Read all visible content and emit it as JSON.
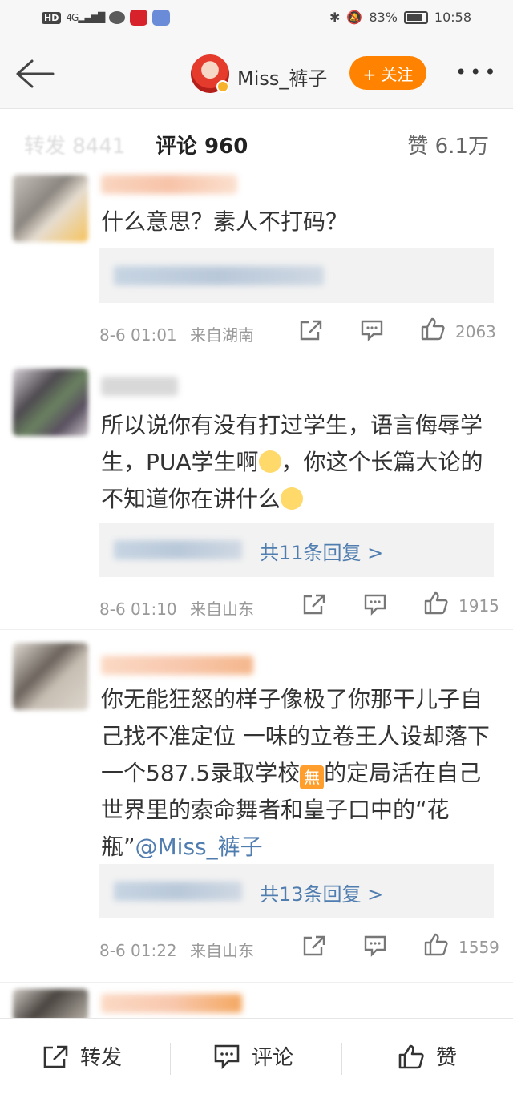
{
  "status_bar": {
    "network": "HD",
    "signal": "4G",
    "battery": "83%",
    "time": "10:58"
  },
  "nav": {
    "user_name": "Miss_裤子",
    "follow_label": "+ 关注",
    "more_label": "•••"
  },
  "tabs": {
    "repost_label": "转发 8441",
    "comment_label": "评论 960",
    "like_label": "赞 6.1万"
  },
  "comments": [
    {
      "text": "什么意思？素人不打码？",
      "time": "8-6 01:01",
      "location": "来自湖南",
      "likes": "2063",
      "reply_link": ""
    },
    {
      "text_a": "所以说你有没有打过学生，语言侮辱学生，PUA学生啊",
      "text_b": "，你这个长篇大论的不知道你在讲什么",
      "time": "8-6 01:10",
      "location": "来自山东",
      "likes": "1915",
      "reply_link": "共11条回复 >"
    },
    {
      "text_a": "你无能狂怒的样子像极了你那干儿子自己找不准定位 一味的立卷王人设却落下一个587.5录取学校",
      "emoji_label": "無",
      "text_b": "的定局活在自己世界里的索命舞者和皇子口中的“花瓶”",
      "mention": "@Miss_裤子",
      "time": "8-6 01:22",
      "location": "来自山东",
      "likes": "1559",
      "reply_link": "共13条回复 >"
    }
  ],
  "bottom_bar": {
    "repost": "转发",
    "comment": "评论",
    "like": "赞"
  },
  "colors": {
    "accent_orange": "#ff8200",
    "link_blue": "#507daf",
    "muted_gray": "#999999"
  }
}
